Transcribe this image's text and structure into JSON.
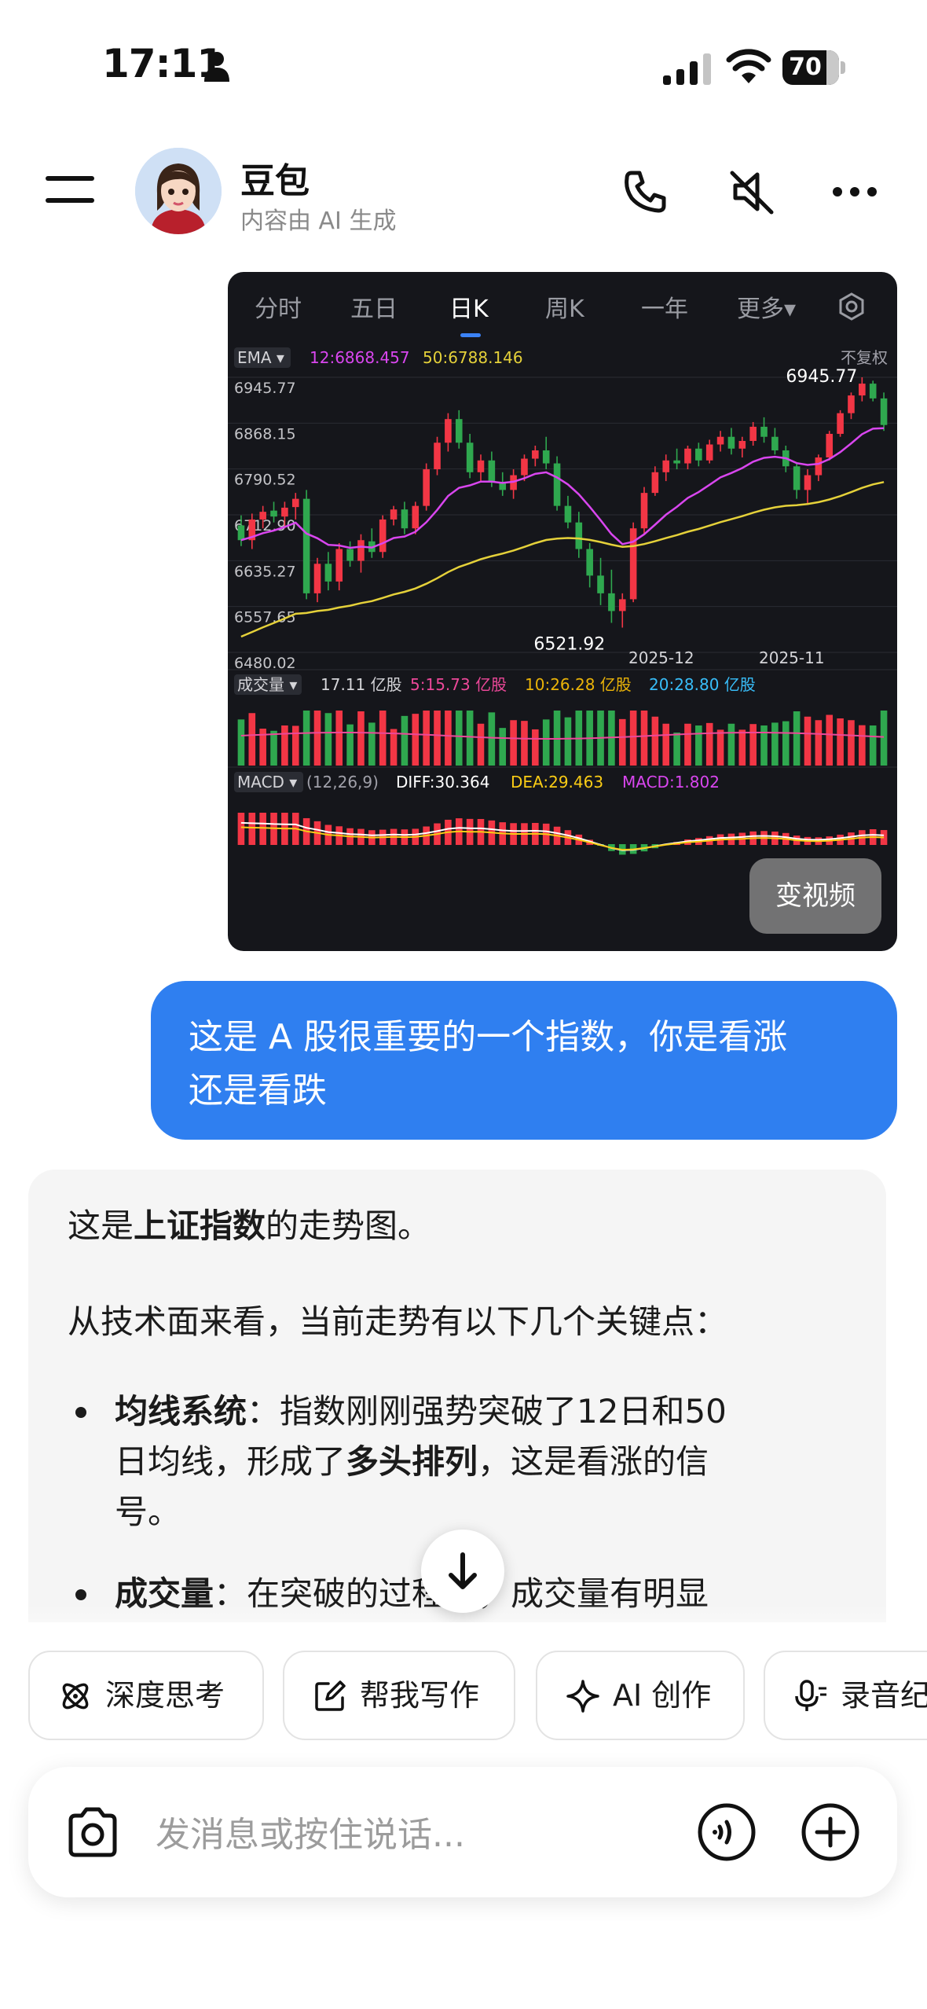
{
  "status_bar": {
    "time": "17:11",
    "battery": "70",
    "icons": [
      "person-icon",
      "signal-icon",
      "wifi-icon",
      "battery-icon"
    ]
  },
  "header": {
    "title": "豆包",
    "subtitle": "内容由 AI 生成",
    "icons": [
      "menu-icon",
      "phone-icon",
      "speaker-muted-icon",
      "more-icon"
    ]
  },
  "chart_card": {
    "tabs": [
      {
        "label": "分时"
      },
      {
        "label": "五日"
      },
      {
        "label": "日K"
      },
      {
        "label": "周K"
      },
      {
        "label": "一年"
      },
      {
        "label": "更多▾"
      }
    ],
    "active_tab": "日K",
    "video_button": "变视频"
  },
  "chart_data": {
    "type": "candlestick",
    "indicator_label": "EMA ▾",
    "ema12": "12:6868.457",
    "ema50": "50:6788.146",
    "adjust_label": "不复权",
    "y_ticks": [
      "6945.77",
      "6868.15",
      "6790.52",
      "6712.90",
      "6635.27",
      "6557.65",
      "6480.02"
    ],
    "x_ticks": [
      "2025-11",
      "2025-12"
    ],
    "high_label": "6945.77",
    "low_label": "6521.92",
    "ylim": [
      6480.02,
      6945.77
    ],
    "ohlc": [
      [
        6695,
        6712,
        6660,
        6670
      ],
      [
        6670,
        6715,
        6655,
        6705
      ],
      [
        6705,
        6728,
        6690,
        6718
      ],
      [
        6720,
        6735,
        6700,
        6710
      ],
      [
        6710,
        6735,
        6690,
        6725
      ],
      [
        6726,
        6750,
        6705,
        6740
      ],
      [
        6740,
        6755,
        6570,
        6580
      ],
      [
        6580,
        6640,
        6565,
        6630
      ],
      [
        6630,
        6650,
        6585,
        6600
      ],
      [
        6600,
        6665,
        6585,
        6655
      ],
      [
        6655,
        6668,
        6625,
        6635
      ],
      [
        6635,
        6680,
        6615,
        6670
      ],
      [
        6668,
        6690,
        6640,
        6650
      ],
      [
        6650,
        6712,
        6640,
        6705
      ],
      [
        6705,
        6728,
        6695,
        6722
      ],
      [
        6722,
        6735,
        6680,
        6690
      ],
      [
        6690,
        6735,
        6680,
        6728
      ],
      [
        6728,
        6800,
        6720,
        6790
      ],
      [
        6790,
        6845,
        6780,
        6835
      ],
      [
        6835,
        6885,
        6820,
        6875
      ],
      [
        6875,
        6890,
        6825,
        6835
      ],
      [
        6835,
        6850,
        6775,
        6785
      ],
      [
        6785,
        6815,
        6770,
        6805
      ],
      [
        6805,
        6820,
        6760,
        6768
      ],
      [
        6768,
        6785,
        6745,
        6755
      ],
      [
        6755,
        6790,
        6740,
        6780
      ],
      [
        6780,
        6815,
        6770,
        6808
      ],
      [
        6808,
        6830,
        6795,
        6822
      ],
      [
        6822,
        6845,
        6790,
        6800
      ],
      [
        6800,
        6812,
        6720,
        6728
      ],
      [
        6728,
        6745,
        6690,
        6700
      ],
      [
        6700,
        6718,
        6640,
        6655
      ],
      [
        6655,
        6665,
        6590,
        6610
      ],
      [
        6610,
        6640,
        6560,
        6580
      ],
      [
        6580,
        6620,
        6530,
        6550
      ],
      [
        6550,
        6580,
        6521.92,
        6570
      ],
      [
        6570,
        6700,
        6565,
        6690
      ],
      [
        6690,
        6760,
        6680,
        6750
      ],
      [
        6750,
        6795,
        6745,
        6785
      ],
      [
        6785,
        6815,
        6770,
        6805
      ],
      [
        6805,
        6825,
        6790,
        6800
      ],
      [
        6800,
        6830,
        6790,
        6825
      ],
      [
        6825,
        6835,
        6795,
        6805
      ],
      [
        6805,
        6840,
        6800,
        6832
      ],
      [
        6832,
        6855,
        6820,
        6845
      ],
      [
        6845,
        6860,
        6815,
        6825
      ],
      [
        6825,
        6845,
        6810,
        6838
      ],
      [
        6838,
        6870,
        6830,
        6862
      ],
      [
        6862,
        6878,
        6835,
        6845
      ],
      [
        6845,
        6860,
        6815,
        6822
      ],
      [
        6822,
        6830,
        6785,
        6795
      ],
      [
        6795,
        6800,
        6740,
        6755
      ],
      [
        6755,
        6790,
        6730,
        6780
      ],
      [
        6780,
        6815,
        6770,
        6810
      ],
      [
        6810,
        6855,
        6805,
        6850
      ],
      [
        6850,
        6890,
        6845,
        6885
      ],
      [
        6885,
        6920,
        6875,
        6915
      ],
      [
        6915,
        6945.77,
        6905,
        6935
      ],
      [
        6935,
        6940,
        6905,
        6910
      ],
      [
        6910,
        6920,
        6855,
        6865
      ]
    ],
    "volume": {
      "label": "成交量 ▾",
      "total": "17.11 亿股",
      "ma5": "5:15.73 亿股",
      "ma10": "10:26.28 亿股",
      "ma20": "20:28.80 亿股"
    },
    "macd": {
      "label": "MACD ▾",
      "params": "(12,26,9)",
      "diff": "DIFF:30.364",
      "dea": "DEA:29.463",
      "macd": "MACD:1.802"
    },
    "colors": {
      "up": "#f23645",
      "down": "#2fa84f",
      "ema12": "#d946ef",
      "ema50": "#e5d13a",
      "ma5": "#ec4899",
      "ma10": "#eab308",
      "ma20": "#38bdf8",
      "diff": "#ffffff",
      "dea": "#facc15"
    }
  },
  "user_message": {
    "line1": "这是 A 股很重要的一个指数，你是看涨",
    "line2": "还是看跌"
  },
  "bot_reply": {
    "p1_prefix": "这是",
    "p1_bold": "上证指数",
    "p1_suffix": "的走势图。",
    "p2": "从技术面来看，当前走势有以下几个关键点：",
    "bullet1_bold": "均线系统",
    "bullet1_a": "：指数刚刚强势突破了12日和50",
    "bullet1_b": "日均线，形成了",
    "bullet1_bold2": "多头排列",
    "bullet1_c": "，这是看涨的信",
    "bullet1_d": "号。",
    "bullet2_bold": "成交量",
    "bullet2_a": "：在突破的过程中，成交量有明显"
  },
  "quick_actions": [
    {
      "label": "深度思考",
      "icon": "atom-icon"
    },
    {
      "label": "帮我写作",
      "icon": "edit-icon"
    },
    {
      "label": "AI 创作",
      "icon": "sparkle-icon"
    },
    {
      "label": "录音纪",
      "icon": "mic-icon"
    }
  ],
  "input": {
    "placeholder": "发消息或按住说话..."
  }
}
